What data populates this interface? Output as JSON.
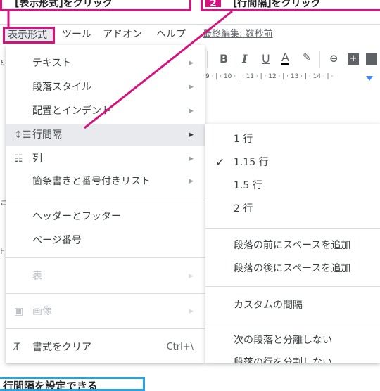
{
  "callouts": {
    "top_left": "[表示形式]をクリック",
    "top_right_num": "2",
    "top_right": "[行間隔]をクリック",
    "bottom": "行間隔を設定できる"
  },
  "menubar": {
    "format": "表示形式",
    "tools": "ツール",
    "addons": "アドオン",
    "help": "ヘルプ",
    "last_edit": "最終編集: 数秒前"
  },
  "toolbar": {
    "bold": "B",
    "italic": "I",
    "underline": "U",
    "text_color": "A",
    "ruler": "9 · | · 10 · | · 11 · | · 12 · | · 13 · | · 14 · | ·"
  },
  "format_menu": {
    "text": "テキスト",
    "paragraph_styles": "段落スタイル",
    "align_indent": "配置とインデント",
    "line_spacing": "行間隔",
    "columns": "列",
    "bullets_numbering": "箇条書きと番号付きリスト",
    "headers_footers": "ヘッダーとフッター",
    "page_numbers": "ページ番号",
    "table": "表",
    "image": "画像",
    "clear_formatting": "書式をクリア",
    "clear_shortcut": "Ctrl+\\"
  },
  "spacing_submenu": {
    "single": "1 行",
    "one_fifteen": "1.15 行",
    "one_five": "1.5 行",
    "double": "2 行",
    "add_before": "段落の前にスペースを追加",
    "add_after": "段落の後にスペースを追加",
    "custom": "カスタムの間隔",
    "keep_with_next": "次の段落と分離しない",
    "keep_lines_together": "段落の行を分割しない"
  },
  "colors": {
    "callout_accent": "#d4137f",
    "bottom_accent": "#29a3e0"
  }
}
